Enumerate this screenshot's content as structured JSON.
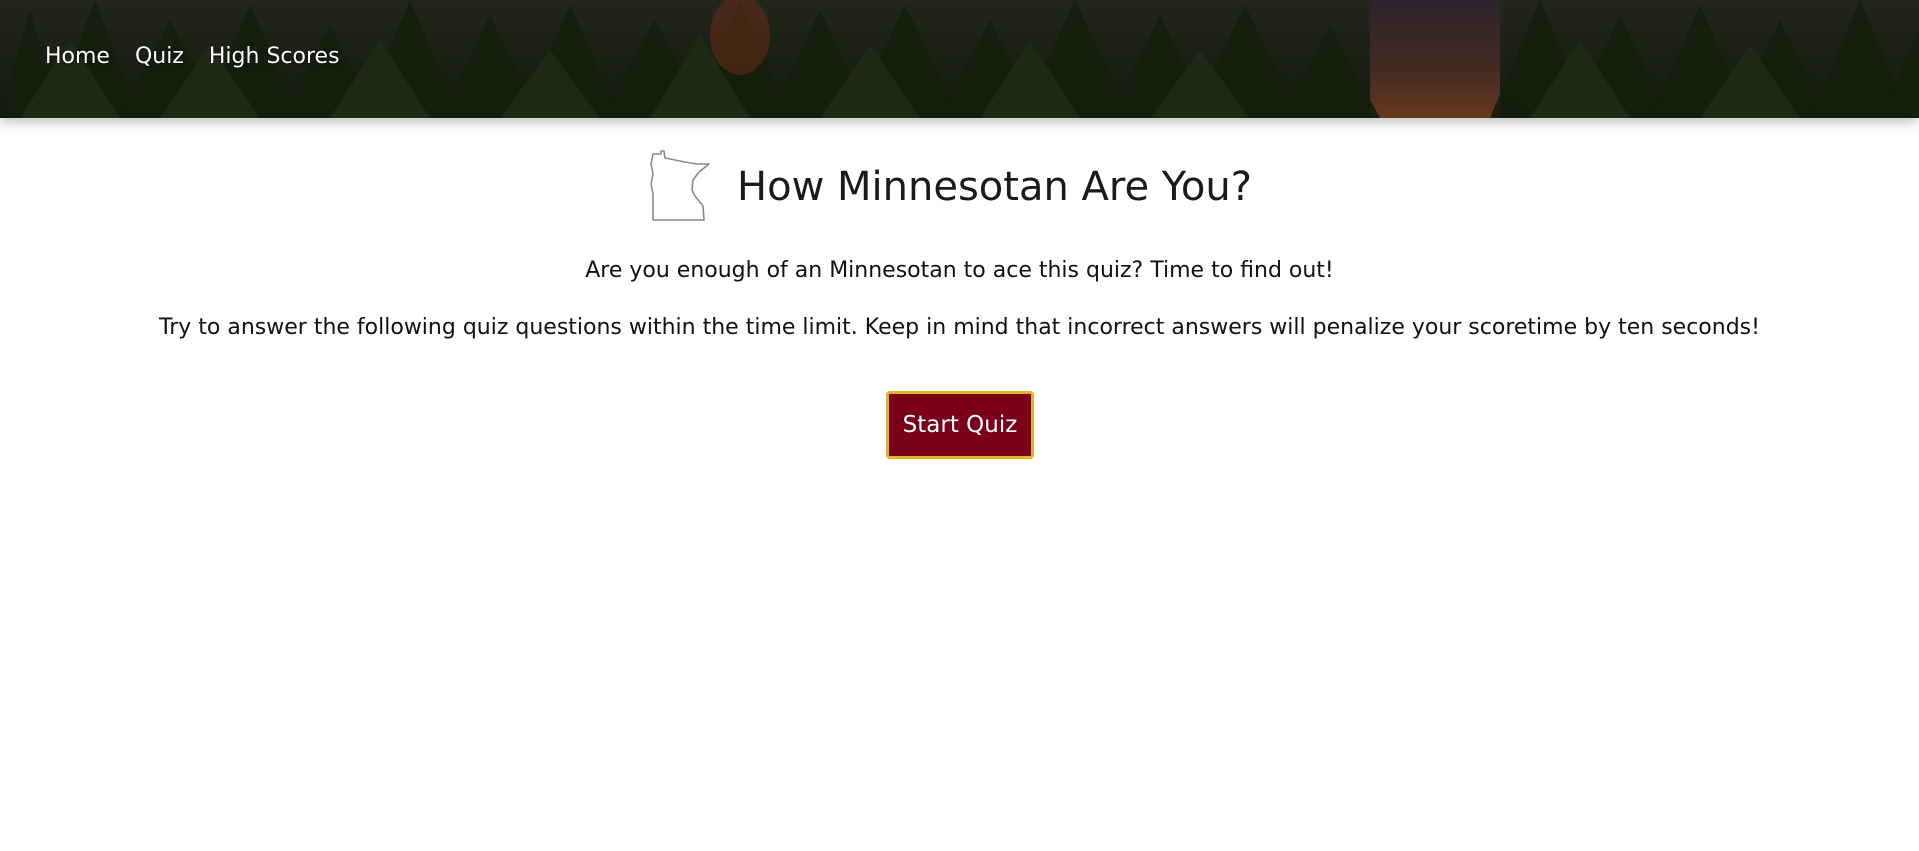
{
  "nav": {
    "items": [
      {
        "label": "Home"
      },
      {
        "label": "Quiz"
      },
      {
        "label": "High Scores"
      }
    ]
  },
  "main": {
    "title": "How Minnesotan Are You?",
    "intro": "Are you enough of an Minnesotan to ace this quiz? Time to find out!",
    "instructions": "Try to answer the following quiz questions within the time limit. Keep in mind that incorrect answers will penalize your scoretime by ten seconds!",
    "start_button": "Start Quiz"
  },
  "colors": {
    "button_bg": "#7a0019",
    "button_border": "#e0b32a",
    "header_dark": "#1f2a17"
  },
  "icons": {
    "state_outline": "minnesota-state-icon"
  }
}
